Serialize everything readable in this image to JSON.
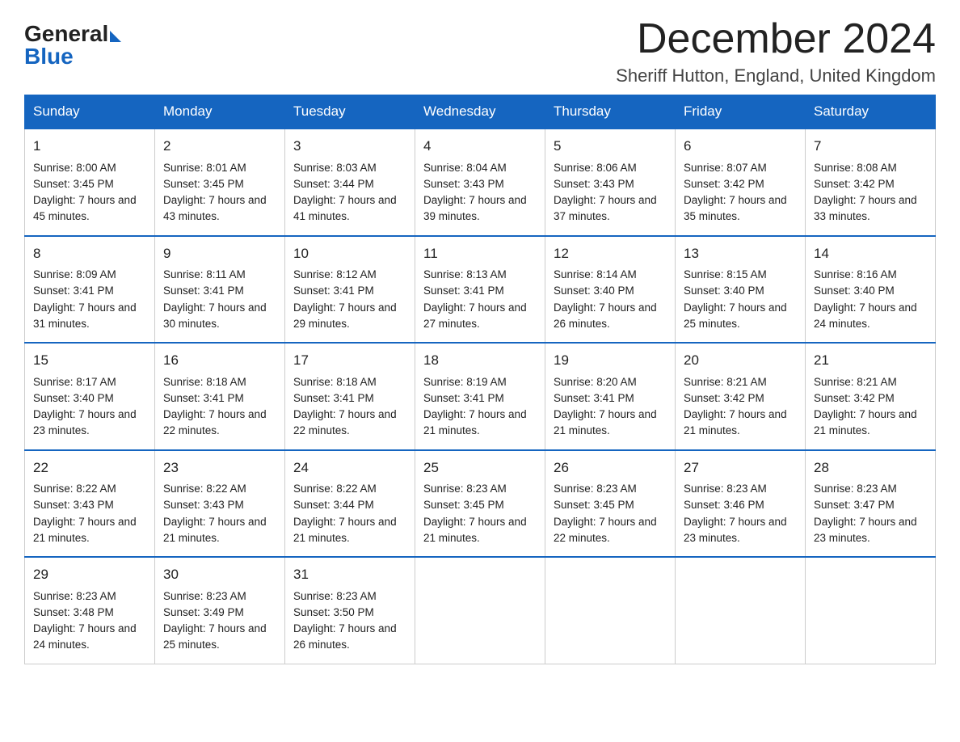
{
  "header": {
    "logo_general": "General",
    "logo_blue": "Blue",
    "month_title": "December 2024",
    "location": "Sheriff Hutton, England, United Kingdom"
  },
  "days_of_week": [
    "Sunday",
    "Monday",
    "Tuesday",
    "Wednesday",
    "Thursday",
    "Friday",
    "Saturday"
  ],
  "weeks": [
    [
      {
        "num": "1",
        "sunrise": "8:00 AM",
        "sunset": "3:45 PM",
        "daylight": "7 hours and 45 minutes."
      },
      {
        "num": "2",
        "sunrise": "8:01 AM",
        "sunset": "3:45 PM",
        "daylight": "7 hours and 43 minutes."
      },
      {
        "num": "3",
        "sunrise": "8:03 AM",
        "sunset": "3:44 PM",
        "daylight": "7 hours and 41 minutes."
      },
      {
        "num": "4",
        "sunrise": "8:04 AM",
        "sunset": "3:43 PM",
        "daylight": "7 hours and 39 minutes."
      },
      {
        "num": "5",
        "sunrise": "8:06 AM",
        "sunset": "3:43 PM",
        "daylight": "7 hours and 37 minutes."
      },
      {
        "num": "6",
        "sunrise": "8:07 AM",
        "sunset": "3:42 PM",
        "daylight": "7 hours and 35 minutes."
      },
      {
        "num": "7",
        "sunrise": "8:08 AM",
        "sunset": "3:42 PM",
        "daylight": "7 hours and 33 minutes."
      }
    ],
    [
      {
        "num": "8",
        "sunrise": "8:09 AM",
        "sunset": "3:41 PM",
        "daylight": "7 hours and 31 minutes."
      },
      {
        "num": "9",
        "sunrise": "8:11 AM",
        "sunset": "3:41 PM",
        "daylight": "7 hours and 30 minutes."
      },
      {
        "num": "10",
        "sunrise": "8:12 AM",
        "sunset": "3:41 PM",
        "daylight": "7 hours and 29 minutes."
      },
      {
        "num": "11",
        "sunrise": "8:13 AM",
        "sunset": "3:41 PM",
        "daylight": "7 hours and 27 minutes."
      },
      {
        "num": "12",
        "sunrise": "8:14 AM",
        "sunset": "3:40 PM",
        "daylight": "7 hours and 26 minutes."
      },
      {
        "num": "13",
        "sunrise": "8:15 AM",
        "sunset": "3:40 PM",
        "daylight": "7 hours and 25 minutes."
      },
      {
        "num": "14",
        "sunrise": "8:16 AM",
        "sunset": "3:40 PM",
        "daylight": "7 hours and 24 minutes."
      }
    ],
    [
      {
        "num": "15",
        "sunrise": "8:17 AM",
        "sunset": "3:40 PM",
        "daylight": "7 hours and 23 minutes."
      },
      {
        "num": "16",
        "sunrise": "8:18 AM",
        "sunset": "3:41 PM",
        "daylight": "7 hours and 22 minutes."
      },
      {
        "num": "17",
        "sunrise": "8:18 AM",
        "sunset": "3:41 PM",
        "daylight": "7 hours and 22 minutes."
      },
      {
        "num": "18",
        "sunrise": "8:19 AM",
        "sunset": "3:41 PM",
        "daylight": "7 hours and 21 minutes."
      },
      {
        "num": "19",
        "sunrise": "8:20 AM",
        "sunset": "3:41 PM",
        "daylight": "7 hours and 21 minutes."
      },
      {
        "num": "20",
        "sunrise": "8:21 AM",
        "sunset": "3:42 PM",
        "daylight": "7 hours and 21 minutes."
      },
      {
        "num": "21",
        "sunrise": "8:21 AM",
        "sunset": "3:42 PM",
        "daylight": "7 hours and 21 minutes."
      }
    ],
    [
      {
        "num": "22",
        "sunrise": "8:22 AM",
        "sunset": "3:43 PM",
        "daylight": "7 hours and 21 minutes."
      },
      {
        "num": "23",
        "sunrise": "8:22 AM",
        "sunset": "3:43 PM",
        "daylight": "7 hours and 21 minutes."
      },
      {
        "num": "24",
        "sunrise": "8:22 AM",
        "sunset": "3:44 PM",
        "daylight": "7 hours and 21 minutes."
      },
      {
        "num": "25",
        "sunrise": "8:23 AM",
        "sunset": "3:45 PM",
        "daylight": "7 hours and 21 minutes."
      },
      {
        "num": "26",
        "sunrise": "8:23 AM",
        "sunset": "3:45 PM",
        "daylight": "7 hours and 22 minutes."
      },
      {
        "num": "27",
        "sunrise": "8:23 AM",
        "sunset": "3:46 PM",
        "daylight": "7 hours and 23 minutes."
      },
      {
        "num": "28",
        "sunrise": "8:23 AM",
        "sunset": "3:47 PM",
        "daylight": "7 hours and 23 minutes."
      }
    ],
    [
      {
        "num": "29",
        "sunrise": "8:23 AM",
        "sunset": "3:48 PM",
        "daylight": "7 hours and 24 minutes."
      },
      {
        "num": "30",
        "sunrise": "8:23 AM",
        "sunset": "3:49 PM",
        "daylight": "7 hours and 25 minutes."
      },
      {
        "num": "31",
        "sunrise": "8:23 AM",
        "sunset": "3:50 PM",
        "daylight": "7 hours and 26 minutes."
      },
      null,
      null,
      null,
      null
    ]
  ]
}
